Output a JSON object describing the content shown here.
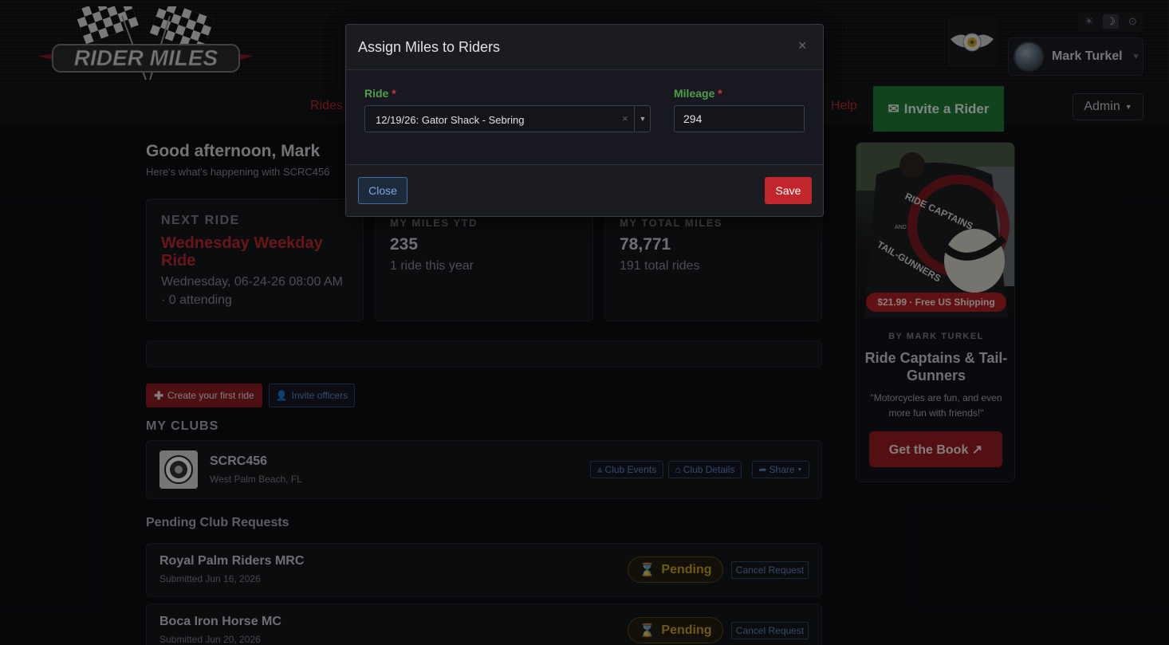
{
  "header": {
    "logo_text": "RIDER MILES",
    "theme": {
      "light_icon": "sun-icon",
      "dark_icon": "moon-icon",
      "auto_icon": "circle-icon",
      "active": "dark"
    },
    "user": {
      "name": "Mark Turkel"
    }
  },
  "nav": {
    "rides": "Rides",
    "help": "Help",
    "invite_label": "Invite a Rider",
    "admin_label": "Admin"
  },
  "main": {
    "greeting": "Good afternoon, Mark",
    "subtitle": "Here's what's happening with SCRC456",
    "next_ride": {
      "label": "NEXT RIDE",
      "title": "Wednesday Weekday Ride",
      "datetime": "Wednesday, 06-24-26 08:00 AM",
      "attending": "· 0 attending"
    },
    "miles_ytd": {
      "label": "MY MILES YTD",
      "value": "235",
      "sub": "1 ride this year"
    },
    "total_miles": {
      "label": "MY TOTAL MILES",
      "value": "78,771",
      "sub": "191 total rides"
    },
    "create_ride_label": "Create your first ride",
    "invite_officers_label": "Invite officers",
    "my_clubs_title": "MY CLUBS",
    "club": {
      "name": "SCRC456",
      "location": "West Palm Beach, FL",
      "events_label": "Club Events",
      "details_label": "Club Details",
      "share_label": "Share"
    },
    "pending_title": "Pending Club Requests",
    "requests": [
      {
        "name": "Royal Palm Riders MRC",
        "submitted": "Submitted Jun 16, 2026",
        "status": "Pending",
        "cancel": "Cancel Request"
      },
      {
        "name": "Boca Iron Horse MC",
        "submitted": "Submitted Jun 20, 2026",
        "status": "Pending",
        "cancel": "Cancel Request"
      }
    ]
  },
  "book": {
    "price": "$21.99 · Free US Shipping",
    "author": "BY MARK TURKEL",
    "title": "Ride Captains & Tail-Gunners",
    "quote": "\"Motorcycles are fun, and even more fun with friends!\"",
    "cta": "Get the Book ↗",
    "jacket_top": "RIDE CAPTAINS",
    "jacket_mid": "AND",
    "jacket_bottom": "TAIL-GUNNERS"
  },
  "modal": {
    "title": "Assign Miles to Riders",
    "close_icon": "×",
    "ride_label": "Ride",
    "required_mark": "*",
    "ride_value": "12/19/26: Gator Shack - Sebring",
    "clear_mark": "×",
    "mileage_label": "Mileage",
    "mileage_value": "294",
    "close_label": "Close",
    "save_label": "Save"
  }
}
